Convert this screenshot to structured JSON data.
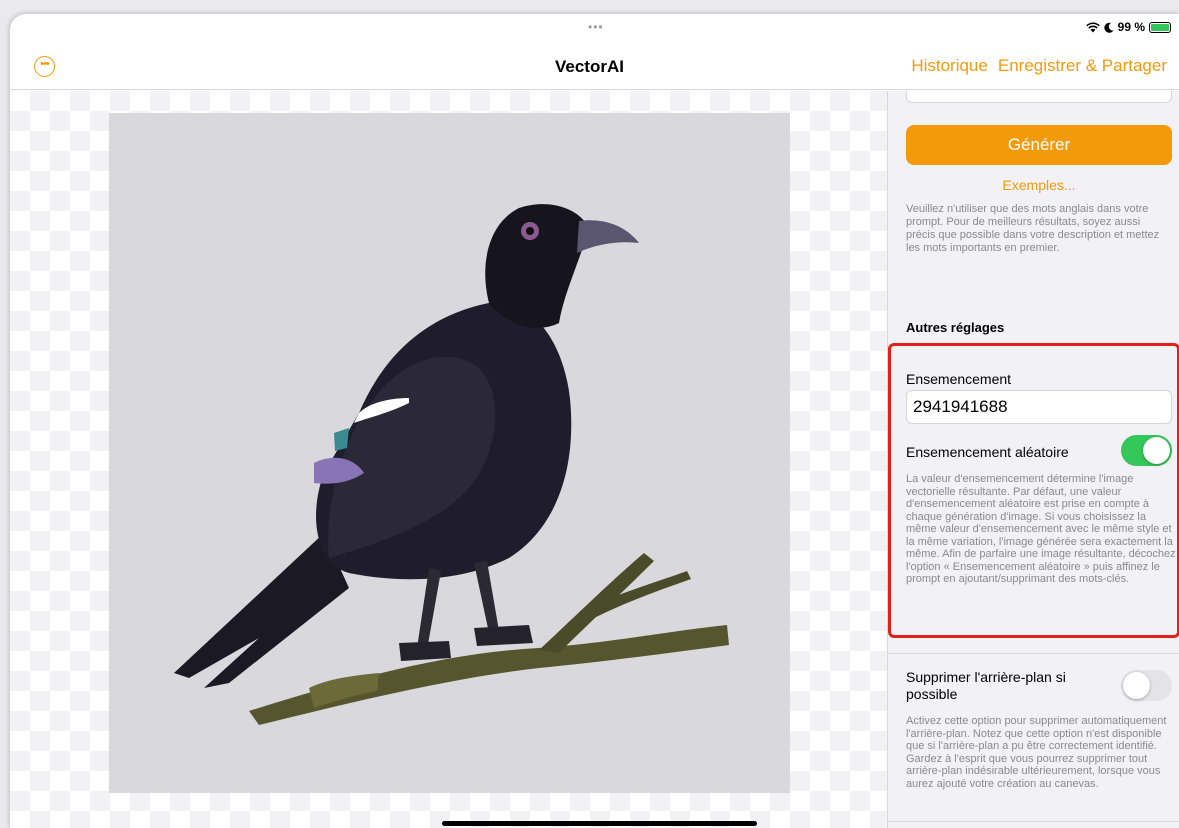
{
  "status_bar": {
    "handle": "•••",
    "wifi_icon": "wifi-icon",
    "focus_icon": "moon-icon",
    "battery_text": "99 %",
    "battery_level": 0.99
  },
  "nav": {
    "title": "VectorAI",
    "more_icon": "ellipsis-circle-icon",
    "history_label": "Historique",
    "save_share_label": "Enregistrer & Partager"
  },
  "panel": {
    "generate_label": "Générer",
    "examples_label": "Exemples...",
    "prompt_hint": "Veuillez n'utiliser que des mots anglais dans votre prompt. Pour de meilleurs résultats, soyez aussi précis que possible dans votre description et mettez les mots importants en premier.",
    "other_settings_title": "Autres réglages",
    "seed_label": "Ensemencement",
    "seed_value": "2941941688",
    "random_seed_label": "Ensemencement aléatoire",
    "random_seed_on": true,
    "seed_description": "La valeur d'ensemencement détermine l'image vectorielle résultante. Par défaut, une valeur d'ensemencement aléatoire est prise en compte à chaque génération d'image. Si vous choisissez la même valeur d'ensemencement avec le même style et la même variation, l'image générée sera exactement la même. Afin de parfaire une image résultante, décochez l'option « Ensemencement aléatoire » puis affinez le prompt en ajoutant/supprimant des mots-clés.",
    "remove_bg_label": "Supprimer l'arrière-plan si possible",
    "remove_bg_on": false,
    "remove_bg_description": "Activez cette option pour supprimer automatiquement l'arrière-plan. Notez que cette option n'est disponible que si l'arrière-plan a pu être correctement identifié. Gardez à l'esprit que vous pourrez supprimer tout arrière-plan indésirable ultérieurement, lorsque vous aurez ajouté votre création au canevas."
  },
  "colors": {
    "accent": "#f39a0b",
    "toggle_on": "#34c759",
    "highlight": "#e4201b"
  }
}
